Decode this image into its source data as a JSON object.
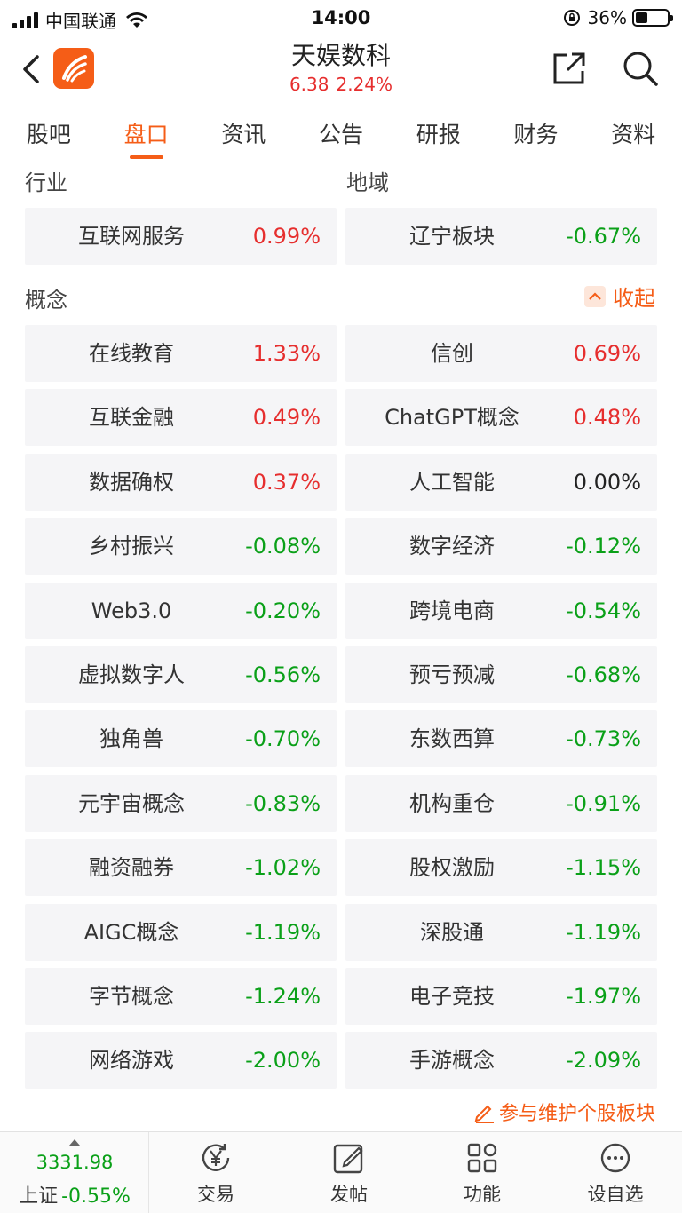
{
  "status_bar": {
    "carrier": "中国联通",
    "time": "14:00",
    "battery_percent": "36%",
    "battery_level": 0.36
  },
  "header": {
    "stock_name": "天娱数科",
    "price": "6.38",
    "change_pct": "2.24%",
    "icons": [
      "back-arrow-icon",
      "app-logo",
      "share-icon",
      "search-icon"
    ]
  },
  "tabs": [
    {
      "label": "股吧",
      "active": false
    },
    {
      "label": "盘口",
      "active": true
    },
    {
      "label": "资讯",
      "active": false
    },
    {
      "label": "公告",
      "active": false
    },
    {
      "label": "研报",
      "active": false
    },
    {
      "label": "财务",
      "active": false
    },
    {
      "label": "资料",
      "active": false
    }
  ],
  "industry": {
    "label": "行业",
    "item": {
      "name": "互联网服务",
      "pct": "0.99%",
      "dir": "up"
    }
  },
  "region": {
    "label": "地域",
    "item": {
      "name": "辽宁板块",
      "pct": "-0.67%",
      "dir": "down"
    }
  },
  "concepts": {
    "label": "概念",
    "collapse_label": "收起",
    "items": [
      {
        "name": "在线教育",
        "pct": "1.33%",
        "dir": "up"
      },
      {
        "name": "信创",
        "pct": "0.69%",
        "dir": "up"
      },
      {
        "name": "互联金融",
        "pct": "0.49%",
        "dir": "up"
      },
      {
        "name": "ChatGPT概念",
        "pct": "0.48%",
        "dir": "up"
      },
      {
        "name": "数据确权",
        "pct": "0.37%",
        "dir": "up"
      },
      {
        "name": "人工智能",
        "pct": "0.00%",
        "dir": "flat"
      },
      {
        "name": "乡村振兴",
        "pct": "-0.08%",
        "dir": "down"
      },
      {
        "name": "数字经济",
        "pct": "-0.12%",
        "dir": "down"
      },
      {
        "name": "Web3.0",
        "pct": "-0.20%",
        "dir": "down"
      },
      {
        "name": "跨境电商",
        "pct": "-0.54%",
        "dir": "down"
      },
      {
        "name": "虚拟数字人",
        "pct": "-0.56%",
        "dir": "down"
      },
      {
        "name": "预亏预减",
        "pct": "-0.68%",
        "dir": "down"
      },
      {
        "name": "独角兽",
        "pct": "-0.70%",
        "dir": "down"
      },
      {
        "name": "东数西算",
        "pct": "-0.73%",
        "dir": "down"
      },
      {
        "name": "元宇宙概念",
        "pct": "-0.83%",
        "dir": "down"
      },
      {
        "name": "机构重仓",
        "pct": "-0.91%",
        "dir": "down"
      },
      {
        "name": "融资融券",
        "pct": "-1.02%",
        "dir": "down"
      },
      {
        "name": "股权激励",
        "pct": "-1.15%",
        "dir": "down"
      },
      {
        "name": "AIGC概念",
        "pct": "-1.19%",
        "dir": "down"
      },
      {
        "name": "深股通",
        "pct": "-1.19%",
        "dir": "down"
      },
      {
        "name": "字节概念",
        "pct": "-1.24%",
        "dir": "down"
      },
      {
        "name": "电子竞技",
        "pct": "-1.97%",
        "dir": "down"
      },
      {
        "name": "网络游戏",
        "pct": "-2.00%",
        "dir": "down"
      },
      {
        "name": "手游概念",
        "pct": "-2.09%",
        "dir": "down"
      }
    ]
  },
  "maintain_link": "参与维护个股板块",
  "bottom_bar": {
    "index_value": "3331.98",
    "index_name": "上证",
    "index_change": "-0.55%",
    "items": [
      {
        "label": "交易",
        "icon": "trade-yen-icon"
      },
      {
        "label": "发帖",
        "icon": "compose-icon"
      },
      {
        "label": "功能",
        "icon": "grid-icon"
      },
      {
        "label": "设自选",
        "icon": "more-dots-icon"
      }
    ]
  },
  "colors": {
    "accent": "#f55d17",
    "up": "#e62e2e",
    "down": "#0aa018",
    "cell_bg": "#f5f5f7"
  }
}
